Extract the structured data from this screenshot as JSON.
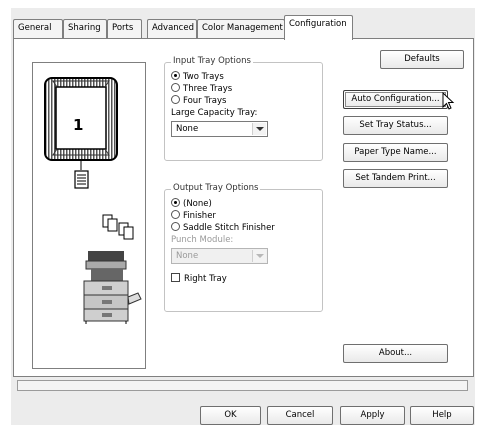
{
  "tabs": [
    {
      "label": "General"
    },
    {
      "label": "Sharing"
    },
    {
      "label": "Ports"
    },
    {
      "label": "Advanced"
    },
    {
      "label": "Color Management"
    },
    {
      "label": "Configuration",
      "active": true
    }
  ],
  "preview": {
    "tray_number": "1"
  },
  "input_tray": {
    "title": "Input Tray Options",
    "options": [
      "Two Trays",
      "Three Trays",
      "Four Trays"
    ],
    "selected": "Two Trays",
    "large_capacity_label": "Large Capacity Tray:",
    "large_capacity_value": "None"
  },
  "output_tray": {
    "title": "Output Tray Options",
    "options": [
      "(None)",
      "Finisher",
      "Saddle Stitch Finisher"
    ],
    "selected": "(None)",
    "punch_label": "Punch Module:",
    "punch_value": "None",
    "right_tray_label": "Right Tray"
  },
  "buttons": {
    "defaults": "Defaults",
    "auto_config": "Auto Configuration...",
    "set_tray_status": "Set Tray Status...",
    "paper_type_name": "Paper Type Name...",
    "set_tandem_print": "Set Tandem Print...",
    "about": "About..."
  },
  "footer": {
    "ok": "OK",
    "cancel": "Cancel",
    "apply": "Apply",
    "help": "Help"
  }
}
